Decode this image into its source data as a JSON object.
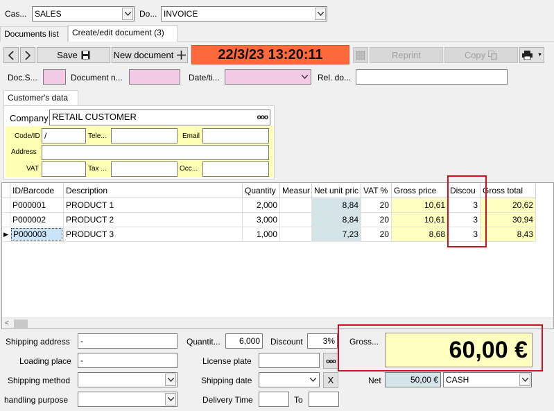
{
  "top": {
    "cash_label": "Cas...",
    "cash_value": "SALES",
    "doc_label": "Do...",
    "doc_value": "INVOICE"
  },
  "tabs": [
    {
      "label": "Documents list"
    },
    {
      "label": "Create/edit document (3)"
    }
  ],
  "toolbar": {
    "prev_icon": "chevron-left-icon",
    "next_icon": "chevron-right-icon",
    "save_label": "Save",
    "save_icon": "floppy-disk-icon",
    "new_label": "New document",
    "new_icon": "plus-icon",
    "datetime": "22/3/23 13:20:11",
    "datetime_color": "#ff6a3d",
    "reprint_label": "Reprint",
    "copy_label": "Copy",
    "print_icon": "printer-icon"
  },
  "docfields": {
    "series_label": "Doc.S...",
    "number_label": "Document n...",
    "date_label": "Date/ti...",
    "rel_label": "Rel. do..."
  },
  "customer": {
    "group_label": "Customer's data",
    "company_label": "Company",
    "company_value": "RETAIL CUSTOMER",
    "company_btn": "ooo",
    "code_label": "Code/ID",
    "code_value": "/",
    "tele_label": "Tele...",
    "email_label": "Email",
    "address_label": "Address",
    "vat_label": "VAT",
    "tax_label": "Tax ...",
    "occ_label": "Occ..."
  },
  "table": {
    "headers": [
      "ID/Barcode",
      "Description",
      "Quantity",
      "Measur",
      "Net unit pric",
      "VAT %",
      "Gross price",
      "Discou",
      "Gross total"
    ],
    "rows": [
      [
        "P000001",
        "PRODUCT 1",
        "2,000",
        "",
        "8,84",
        "20",
        "10,61",
        "3",
        "20,62"
      ],
      [
        "P000002",
        "PRODUCT 2",
        "3,000",
        "",
        "8,84",
        "20",
        "10,61",
        "3",
        "30,94"
      ],
      [
        "P000003",
        "PRODUCT 3",
        "1,000",
        "",
        "7,23",
        "20",
        "8,68",
        "3",
        "8,43"
      ]
    ],
    "current_row": 2
  },
  "footer": {
    "shipping_address_label": "Shipping address",
    "shipping_address_value": "-",
    "loading_place_label": "Loading place",
    "loading_place_value": "-",
    "shipping_method_label": "Shipping method",
    "handling_purpose_label": "handling purpose",
    "quantity_label": "Quantit...",
    "quantity_value": "6,000",
    "discount_label": "Discount",
    "discount_value": "3%",
    "license_plate_label": "License plate",
    "license_btn": "ooo",
    "shipping_date_label": "Shipping date",
    "clear_btn": "X",
    "delivery_time_label": "Delivery Time",
    "to_label": "To",
    "gross_label": "Gross...",
    "gross_value": "60,00 €",
    "net_label": "Net",
    "net_value": "50,00 €",
    "payment_value": "CASH"
  }
}
